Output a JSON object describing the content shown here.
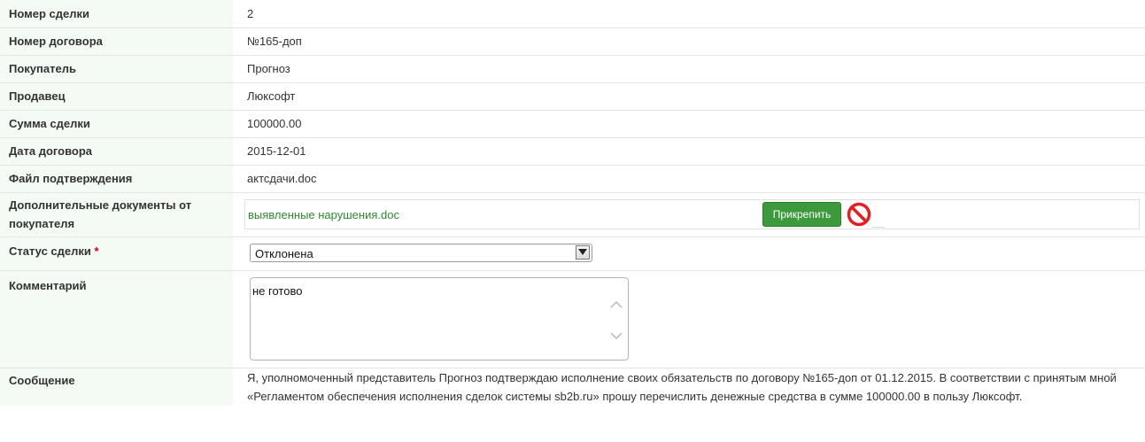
{
  "fields": {
    "deal_number": {
      "label": "Номер сделки",
      "value": "2"
    },
    "contract_number": {
      "label": "Номер договора",
      "value": "№165-доп"
    },
    "buyer": {
      "label": "Покупатель",
      "value": "Прогноз"
    },
    "seller": {
      "label": "Продавец",
      "value": "Люксофт"
    },
    "deal_amount": {
      "label": "Сумма сделки",
      "value": "100000.00"
    },
    "contract_date": {
      "label": "Дата договора",
      "value": "2015-12-01"
    },
    "confirmation_file": {
      "label": "Файл подтверждения",
      "value": "актсдачи.doc"
    },
    "additional_docs": {
      "label": "Дополнительные документы от покупателя",
      "file_name": "выявленные нарушения.doc",
      "attach_label": "Прикрепить"
    },
    "deal_status": {
      "label": "Статус сделки",
      "required_mark": "*",
      "selected": "Отклонена"
    },
    "comment": {
      "label": "Комментарий",
      "value": "не готово"
    },
    "message": {
      "label": "Сообщение",
      "value": "Я, уполномоченный представитель Прогноз подтверждаю исполнение своих обязательств по договору №165-доп от 01.12.2015. В соответствии с принятым мной «Регламентом обеспечения исполнения сделок системы sb2b.ru» прошу перечислить денежные средства в сумме 100000.00 в пользу Люксофт."
    }
  },
  "colors": {
    "label_bg": "#f4faf4",
    "link_green": "#2e8a2e",
    "button_green": "#3c9a3c",
    "required_red": "#d30000",
    "delete_red": "#e02020"
  },
  "icons": {
    "delete": "no-entry-icon",
    "select_arrow": "chevron-down-icon",
    "scroll_up": "chevron-up-icon",
    "scroll_down": "chevron-down-icon"
  }
}
